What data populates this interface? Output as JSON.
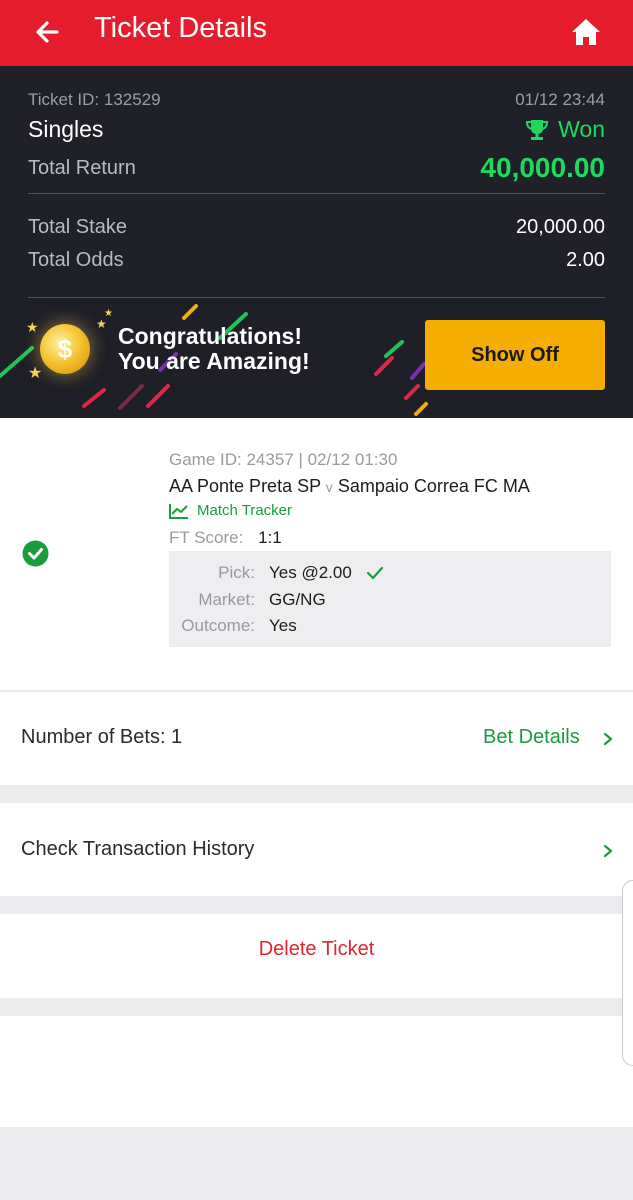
{
  "header": {
    "title": "Ticket Details"
  },
  "summary": {
    "ticket_id": "Ticket ID: 132529",
    "datetime": "01/12 23:44",
    "bet_type": "Singles",
    "status": "Won",
    "total_return_label": "Total Return",
    "total_return": "40,000.00",
    "total_stake_label": "Total Stake",
    "total_stake": "20,000.00",
    "total_odds_label": "Total Odds",
    "total_odds": "2.00"
  },
  "banner": {
    "line1": "Congratulations!",
    "line2": "You are Amazing!",
    "coin_symbol": "$",
    "button": "Show Off"
  },
  "game": {
    "meta": "Game ID: 24357 | 02/12 01:30",
    "home": "AA Ponte Preta SP",
    "vs": "v",
    "away": "Sampaio Correa FC MA",
    "tracker": "Match Tracker",
    "ft_label": "FT Score:",
    "ft_score": "1:1",
    "pick_label": "Pick:",
    "pick_value": "Yes @2.00",
    "market_label": "Market:",
    "market_value": "GG/NG",
    "outcome_label": "Outcome:",
    "outcome_value": "Yes"
  },
  "bets": {
    "label": "Number of Bets: 1",
    "link": "Bet Details"
  },
  "transaction": {
    "label": "Check Transaction History"
  },
  "delete": {
    "label": "Delete Ticket"
  },
  "colors": {
    "brand_red": "#e41c2b",
    "won_green": "#1fd95e",
    "link_green": "#1b9c3c",
    "button_yellow": "#f5ad00"
  }
}
